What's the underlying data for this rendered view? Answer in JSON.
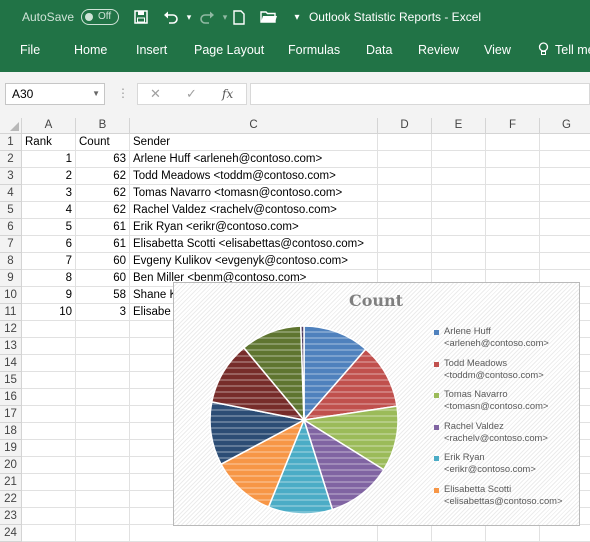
{
  "titlebar": {
    "autosave_label": "AutoSave",
    "autosave_state": "Off",
    "title": "Outlook Statistic Reports  -  Excel",
    "qa_icons": [
      "save-icon",
      "undo-icon",
      "redo-icon",
      "new-file-icon",
      "open-folder-icon",
      "customize-dropdown-icon"
    ]
  },
  "ribbon": {
    "tabs": [
      "File",
      "Home",
      "Insert",
      "Page Layout",
      "Formulas",
      "Data",
      "Review",
      "View",
      "Tell me"
    ]
  },
  "formula_bar": {
    "name_box": "A30",
    "fx_label": "fx",
    "value": ""
  },
  "columns": [
    "A",
    "B",
    "C",
    "D",
    "E",
    "F",
    "G"
  ],
  "rows": [
    "1",
    "2",
    "3",
    "4",
    "5",
    "6",
    "7",
    "8",
    "9",
    "10",
    "11",
    "12",
    "13",
    "14",
    "15",
    "16",
    "17",
    "18",
    "19",
    "20",
    "21",
    "22",
    "23",
    "24"
  ],
  "sheet": {
    "header": {
      "a": "Rank",
      "b": "Count",
      "c": "Sender"
    },
    "data": [
      {
        "rank": "1",
        "count": "63",
        "sender": "Arlene Huff <arleneh@contoso.com>"
      },
      {
        "rank": "2",
        "count": "62",
        "sender": "Todd Meadows <toddm@contoso.com>"
      },
      {
        "rank": "3",
        "count": "62",
        "sender": "Tomas Navarro <tomasn@contoso.com>"
      },
      {
        "rank": "4",
        "count": "62",
        "sender": "Rachel Valdez <rachelv@contoso.com>"
      },
      {
        "rank": "5",
        "count": "61",
        "sender": "Erik Ryan <erikr@contoso.com>"
      },
      {
        "rank": "6",
        "count": "61",
        "sender": "Elisabetta Scotti <elisabettas@contoso.com>"
      },
      {
        "rank": "7",
        "count": "60",
        "sender": "Evgeny Kulikov <evgenyk@contoso.com>"
      },
      {
        "rank": "8",
        "count": "60",
        "sender": "Ben Miller <benm@contoso.com>"
      },
      {
        "rank": "9",
        "count": "58",
        "sender": "Shane K"
      },
      {
        "rank": "10",
        "count": "3",
        "sender": "Elisabe"
      }
    ]
  },
  "chart": {
    "title": "Count",
    "legend": [
      {
        "name": "Arlene Huff",
        "email": "<arleneh@contoso.com>",
        "color": "#4f81bd"
      },
      {
        "name": "Todd Meadows",
        "email": "<toddm@contoso.com>",
        "color": "#c0504d"
      },
      {
        "name": "Tomas Navarro",
        "email": "<tomasn@contoso.com>",
        "color": "#9bbb59"
      },
      {
        "name": "Rachel Valdez",
        "email": "<rachelv@contoso.com>",
        "color": "#8064a2"
      },
      {
        "name": "Erik Ryan",
        "email": "<erikr@contoso.com>",
        "color": "#4bacc6"
      },
      {
        "name": "Elisabetta Scotti",
        "email": "<elisabettas@contoso.com>",
        "color": "#f79646"
      }
    ],
    "slice_colors": [
      "#4f81bd",
      "#c0504d",
      "#9bbb59",
      "#8064a2",
      "#4bacc6",
      "#f79646",
      "#2c4d75",
      "#772c2a",
      "#5f7530",
      "#4d3b62"
    ]
  },
  "chart_data": {
    "type": "pie",
    "title": "Count",
    "categories": [
      "Arlene Huff <arleneh@contoso.com>",
      "Todd Meadows <toddm@contoso.com>",
      "Tomas Navarro <tomasn@contoso.com>",
      "Rachel Valdez <rachelv@contoso.com>",
      "Erik Ryan <erikr@contoso.com>",
      "Elisabetta Scotti <elisabettas@contoso.com>",
      "Evgeny Kulikov <evgenyk@contoso.com>",
      "Ben Miller <benm@contoso.com>",
      "Shane K",
      "Elisabe"
    ],
    "values": [
      63,
      62,
      62,
      62,
      61,
      61,
      60,
      60,
      58,
      3
    ],
    "legend_position": "right"
  }
}
